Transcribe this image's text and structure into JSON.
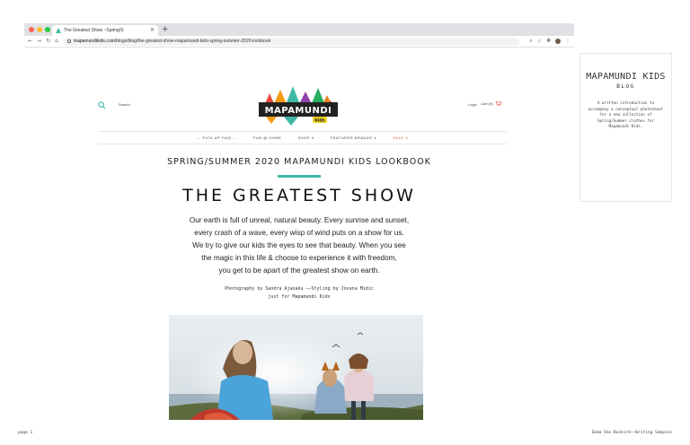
{
  "browser": {
    "tab_title": "The Greatest Show ~Spring/S",
    "url_domain": "mapamundikids.com",
    "url_path": "/blogs/blog/the-greatest-show-mapamundi-kids-spring-summer-2020-lookbook",
    "dot_colors": [
      "#ff5f57",
      "#febc2e",
      "#28c840"
    ]
  },
  "header": {
    "search_label": "Search",
    "logo_text": "MAPAMUNDI",
    "logo_sub": "kids",
    "login_label": "Login",
    "cart_label": "Cart (0)"
  },
  "menu": {
    "items": [
      {
        "label": "← PICK-UP FAQ! ←",
        "sale": false
      },
      {
        "label": "FUN @ HOME",
        "sale": false
      },
      {
        "label": "SHOP ∨",
        "sale": false
      },
      {
        "label": "FEATURED BRANDS ∨",
        "sale": false
      },
      {
        "label": "SALE ∨",
        "sale": true
      }
    ]
  },
  "article": {
    "kicker": "SPRING/SUMMER 2020 MAPAMUNDI KIDS LOOKBOOK",
    "title": "THE GREATEST SHOW",
    "body_lines": [
      "Our earth is full of unreal, natural beauty. Every sunrise and sunset,",
      "every crash of a wave, every wisp of wind puts on a show for us.",
      "We try to give our kids the eyes to see that beauty. When you see",
      "the magic in this life & choose to experience it with freedom,",
      "you get to be apart of the greatest show on earth."
    ],
    "credit_line1": "Photography by Sandra Ajanaku ——Styling by Jovana Midic",
    "credit_line2": "just for Mapamundi Kids",
    "accent_color": "#3fb9a6"
  },
  "side": {
    "title": "MAPAMUNDI KIDS",
    "subtitle": "BLOG",
    "description": "A written introduction to accompany a conceptual photoshoot for a new collection of Spring/Summer clothes for Mapamundi Kids."
  },
  "footer": {
    "left": "page 1",
    "right": "Emma Van Buskirk——Writing Samples"
  }
}
